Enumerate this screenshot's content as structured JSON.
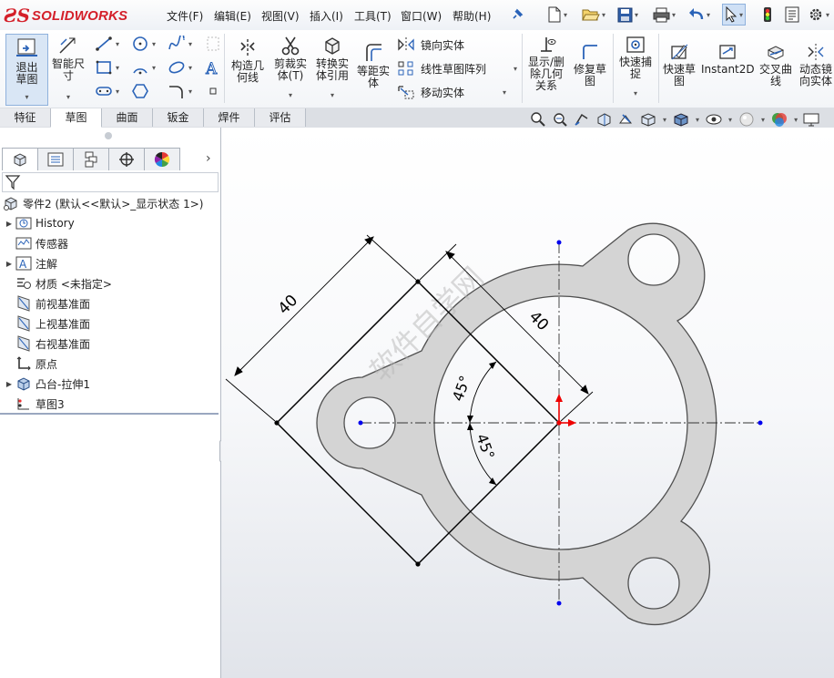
{
  "app": {
    "logo_prefix": "ƧS",
    "logo_text": "SOLIDWORKS"
  },
  "menu": [
    "文件(F)",
    "编辑(E)",
    "视图(V)",
    "插入(I)",
    "工具(T)",
    "窗口(W)",
    "帮助(H)"
  ],
  "ribbon": {
    "exit_sketch": "退出草图",
    "smart_dimension": "智能尺寸",
    "construction_geometry": "构造几何线",
    "trim_entities": "剪裁实体(T)",
    "convert_entities": "转换实体引用",
    "offset_entities": "等距实体",
    "mirror_entities": "镜向实体",
    "linear_pattern": "线性草图阵列",
    "move_entities": "移动实体",
    "display_delete_relations": "显示/删除几何关系",
    "repair_sketch": "修复草图",
    "quick_snaps": "快速捕捉",
    "rapid_sketch": "快速草图",
    "instant2d": "Instant2D",
    "intersection_curve": "交叉曲线",
    "dynamic_mirror": "动态镜向实体"
  },
  "tabs": [
    "特征",
    "草图",
    "曲面",
    "钣金",
    "焊件",
    "评估"
  ],
  "active_tab": "草图",
  "feature_tree": {
    "part": "零件2  (默认<<默认>_显示状态 1>)",
    "items": [
      "History",
      "传感器",
      "注解",
      "材质 <未指定>",
      "前视基准面",
      "上视基准面",
      "右视基准面",
      "原点",
      "凸台-拉伸1",
      "草图3"
    ]
  },
  "sketch": {
    "dimensions": [
      "40",
      "40",
      "45°",
      "45°"
    ],
    "watermark": "软件自学网",
    "colors": {
      "part_fill": "#d4d4d4",
      "sketch_line": "#000000",
      "center_point": "#0000ee",
      "origin": "#ee0000",
      "edge": "#555555"
    }
  }
}
